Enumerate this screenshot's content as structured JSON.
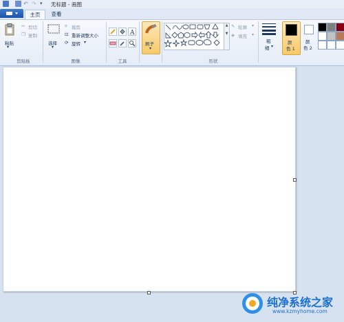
{
  "window": {
    "title": "无标题 - 画图"
  },
  "tabs": [
    {
      "label": "主页",
      "active": true
    },
    {
      "label": "查看",
      "active": false
    }
  ],
  "clipboard": {
    "group_label": "剪贴板",
    "paste": "粘贴",
    "cut": "剪切",
    "copy": "复制"
  },
  "image": {
    "group_label": "图像",
    "select": "选择",
    "crop": "裁剪",
    "resize": "重新调整大小",
    "rotate": "旋转"
  },
  "tools": {
    "group_label": "工具"
  },
  "brushes": {
    "label": "刷子"
  },
  "shapes": {
    "group_label": "形状",
    "outline": "轮廓",
    "fill": "填充"
  },
  "size": {
    "label_1": "粗",
    "label_2": "细"
  },
  "colors": {
    "color1_top": "颜",
    "color1_bottom": "色 1",
    "color2_top": "颜",
    "color2_bottom": "色 2",
    "color1": "#000000",
    "color2": "#ffffff",
    "palette": [
      "#000000",
      "#7f7f7f",
      "#880015",
      "#ffffff",
      "#c3c3c3",
      "#b97a57",
      "#ffffff",
      "#ffffff",
      "#ffffff"
    ]
  },
  "watermark": {
    "title": "纯净系统之家",
    "url": "www.kzmyhome.com"
  }
}
